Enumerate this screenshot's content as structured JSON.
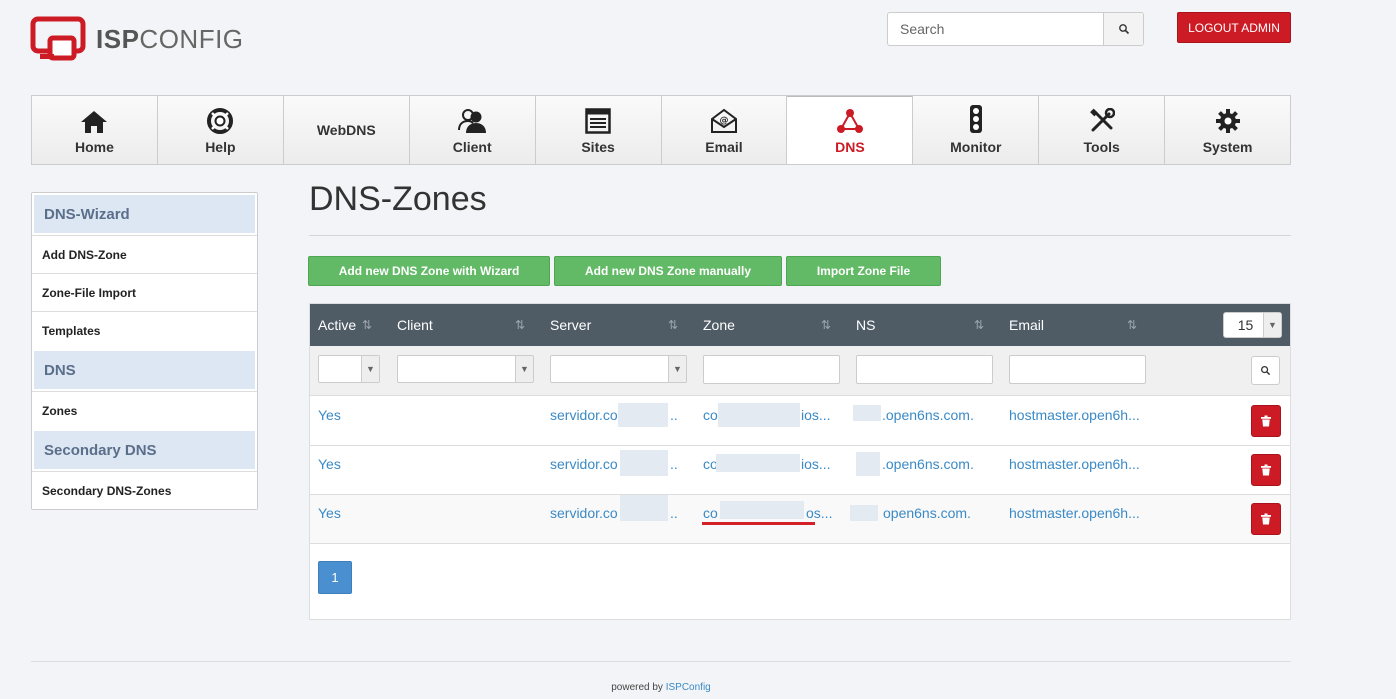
{
  "header": {
    "logo_bold": "ISP",
    "logo_light": "CONFIG",
    "search_placeholder": "Search",
    "logout_label": "LOGOUT ADMIN"
  },
  "nav": [
    {
      "label": "Home",
      "icon": "home-icon"
    },
    {
      "label": "Help",
      "icon": "lifebuoy-icon"
    },
    {
      "label": "WebDNS",
      "icon": ""
    },
    {
      "label": "Client",
      "icon": "users-icon"
    },
    {
      "label": "Sites",
      "icon": "browser-window-icon"
    },
    {
      "label": "Email",
      "icon": "envelope-icon"
    },
    {
      "label": "DNS",
      "icon": "network-triangle-icon",
      "active": true
    },
    {
      "label": "Monitor",
      "icon": "traffic-light-icon"
    },
    {
      "label": "Tools",
      "icon": "tools-icon"
    },
    {
      "label": "System",
      "icon": "gear-icon"
    }
  ],
  "sidebar": {
    "sections": [
      {
        "title": "DNS-Wizard",
        "items": [
          "Add DNS-Zone",
          "Zone-File Import",
          "Templates"
        ]
      },
      {
        "title": "DNS",
        "items": [
          "Zones"
        ]
      },
      {
        "title": "Secondary DNS",
        "items": [
          "Secondary DNS-Zones"
        ]
      }
    ]
  },
  "main": {
    "title": "DNS-Zones",
    "buttons": [
      "Add new DNS Zone with Wizard",
      "Add new DNS Zone manually",
      "Import Zone File"
    ],
    "columns": [
      "Active",
      "Client",
      "Server",
      "Zone",
      "NS",
      "Email"
    ],
    "per_page": "15",
    "rows": [
      {
        "active": "Yes",
        "client": "",
        "server": "servidor.co",
        "server_tail": "..",
        "zone": "co",
        "zone_tail": "ios...",
        "ns": ".open6ns.com.",
        "email": "hostmaster.open6h..."
      },
      {
        "active": "Yes",
        "client": "",
        "server": "servidor.co",
        "server_tail": "..",
        "zone": "co",
        "zone_tail": "ios...",
        "ns": ".open6ns.com.",
        "email": "hostmaster.open6h..."
      },
      {
        "active": "Yes",
        "client": "",
        "server": "servidor.co",
        "server_tail": "..",
        "zone": "co",
        "zone_tail": "os...",
        "ns": "open6ns.com.",
        "email": "hostmaster.open6h..."
      }
    ],
    "page": "1"
  },
  "footer": {
    "prefix": "powered by",
    "link": "ISPConfig"
  },
  "colors": {
    "accent_red": "#cc1b24",
    "green": "#62b966",
    "table_header": "#4f5b65",
    "link_blue": "#3b8ac6"
  }
}
